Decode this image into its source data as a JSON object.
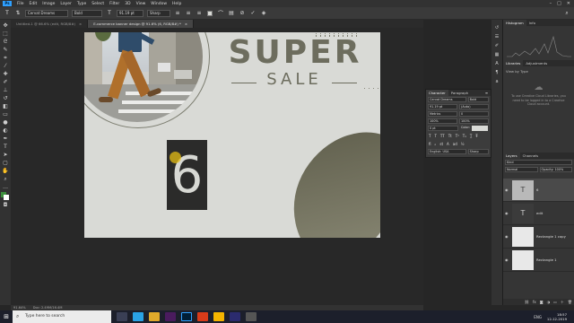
{
  "app": {
    "logo": "Ps",
    "menu": [
      "File",
      "Edit",
      "Image",
      "Layer",
      "Type",
      "Select",
      "Filter",
      "3D",
      "View",
      "Window",
      "Help"
    ],
    "window_controls": [
      "–",
      "□",
      "✕"
    ]
  },
  "options_bar": {
    "font_family": "Cervat Dreams",
    "font_style": "Bold",
    "font_size": "91.19 pt",
    "antialias": "Sharp"
  },
  "tabs": [
    {
      "label": "Untitled-1 @ 66.6% (edit, RGB/8#)",
      "active": false
    },
    {
      "label": "E-commerce banner design @ 91.6% (6, RGB/8#) *",
      "active": true
    }
  ],
  "artwork": {
    "headline": "SUPER",
    "subheadline": "SALE",
    "number": "6"
  },
  "character_panel": {
    "tabs": [
      "Character",
      "Paragraph"
    ],
    "font_family": "Cervat Dreams",
    "font_style": "Bold",
    "size": "91.19 pt",
    "leading": "(Auto)",
    "kerning": "Metrics",
    "tracking": "0",
    "vscale": "100%",
    "hscale": "100%",
    "baseline": "0 pt",
    "color_label": "Color:",
    "language": "English: USA",
    "aa": "Sharp"
  },
  "right_panel": {
    "histogram_tabs": [
      "Histogram",
      "Info"
    ],
    "libraries_tabs": [
      "Libraries",
      "Adjustments"
    ],
    "view_by": "View by Type",
    "libraries_msg": "To use Creative Cloud Libraries, you need to be logged in to a Creative Cloud account.",
    "layers_tabs": [
      "Layers",
      "Channels"
    ],
    "kind": "Kind",
    "blend": "Normal",
    "opacity": "Opacity: 100%",
    "layers": [
      {
        "name": "6",
        "type": "text"
      },
      {
        "name": "edit",
        "type": "text"
      },
      {
        "name": "Rectangle 1 copy",
        "type": "pixel"
      },
      {
        "name": "Rectangle 1",
        "type": "pixel"
      }
    ]
  },
  "status_bar": {
    "zoom": "91.64%",
    "doc": "Doc: 2.49M/16.4M"
  },
  "taskbar": {
    "search_placeholder": "Type here to search",
    "time": "18:57",
    "date": "12-12-2019",
    "lang": "ENG"
  }
}
